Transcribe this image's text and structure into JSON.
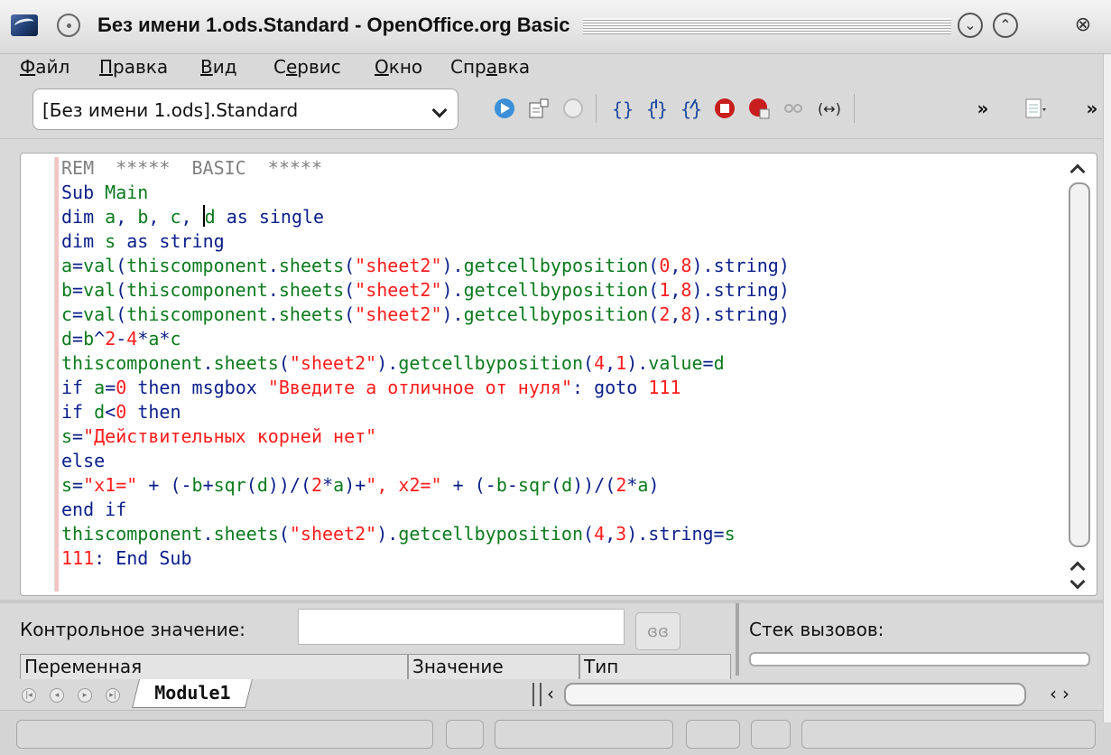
{
  "window": {
    "title": "Без имени 1.ods.Standard - OpenOffice.org Basic"
  },
  "menu": [
    {
      "label_u": "Ф",
      "label_rest": "айл"
    },
    {
      "label_u": "П",
      "label_rest": "равка"
    },
    {
      "label_u": "В",
      "label_rest": "ид"
    },
    {
      "label_pre": "С",
      "label_u": "е",
      "label_rest": "рвис"
    },
    {
      "label_u": "О",
      "label_rest": "кно"
    },
    {
      "label_pre": "Спр",
      "label_u": "а",
      "label_rest": "вка"
    }
  ],
  "toolbar": {
    "library_select": "[Без имени 1.ods].Standard",
    "icons": [
      "run-basic-icon",
      "select-macro-icon",
      "stop-icon",
      "step-over-icon",
      "step-into-icon",
      "step-out-icon",
      "breakpoint-icon",
      "manage-breakpoints-icon",
      "watch-icon",
      "find-parentheses-icon",
      "toolbar-overflow-icon",
      "module-list-icon"
    ]
  },
  "editor": {
    "lines": [
      "REM  *****  BASIC  *****",
      "Sub Main",
      "dim a, b, c, d as single",
      "dim s as string",
      "a=val(thiscomponent.sheets(\"sheet2\").getcellbyposition(0,8).string)",
      "b=val(thiscomponent.sheets(\"sheet2\").getcellbyposition(1,8).string)",
      "c=val(thiscomponent.sheets(\"sheet2\").getcellbyposition(2,8).string)",
      "d=b^2-4*a*c",
      "thiscomponent.sheets(\"sheet2\").getcellbyposition(4,1).value=d",
      "if a=0 then msgbox \"Введите а отличное от нуля\": goto 111",
      "if d<0 then",
      "s=\"Действительных корней нет\"",
      "else",
      "s=\"x1=\" + (-b+sqr(d))/(2*a)+\", x2=\" + (-b-sqr(d))/(2*a)",
      "end if",
      "thiscomponent.sheets(\"sheet2\").getcellbyposition(4,3).string=s",
      "111: End Sub"
    ]
  },
  "watch": {
    "label": "Контрольное значение:",
    "value": "",
    "columns": [
      "Переменная",
      "Значение",
      "Тип"
    ]
  },
  "callstack": {
    "label": "Стек вызовов:"
  },
  "tabs": {
    "active": "Module1"
  },
  "colors": {
    "comment": "#808080",
    "keyword": "#0a1e8a",
    "identifier": "#0b7a1d",
    "string": "#ff1c1c"
  }
}
